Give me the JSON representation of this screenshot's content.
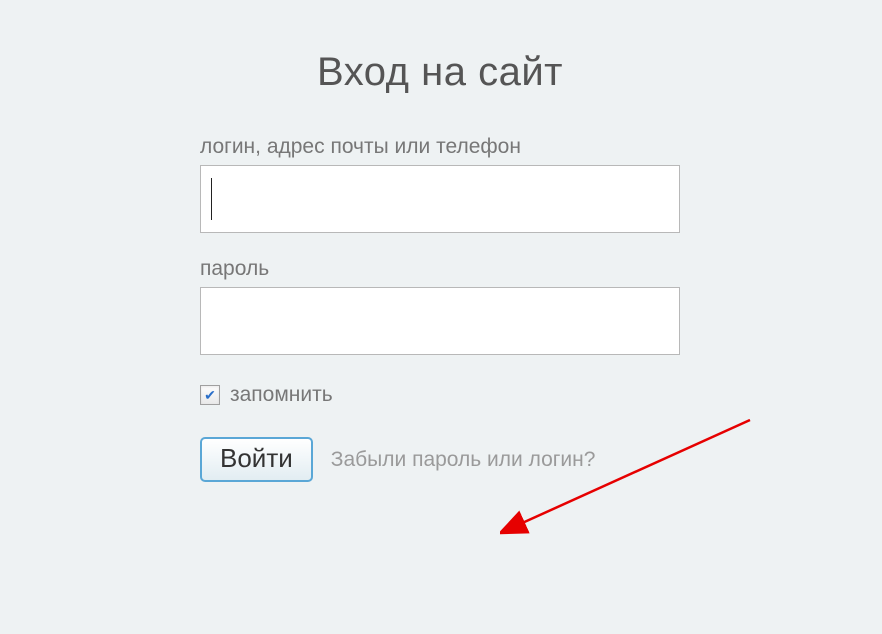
{
  "title": "Вход на сайт",
  "login": {
    "label": "логин, адрес почты или телефон",
    "value": ""
  },
  "password": {
    "label": "пароль",
    "value": ""
  },
  "remember": {
    "label": "запомнить",
    "checked": true,
    "checkmark": "✔"
  },
  "submit": {
    "label": "Войти"
  },
  "forgot": {
    "label": "Забыли пароль или логин?"
  }
}
